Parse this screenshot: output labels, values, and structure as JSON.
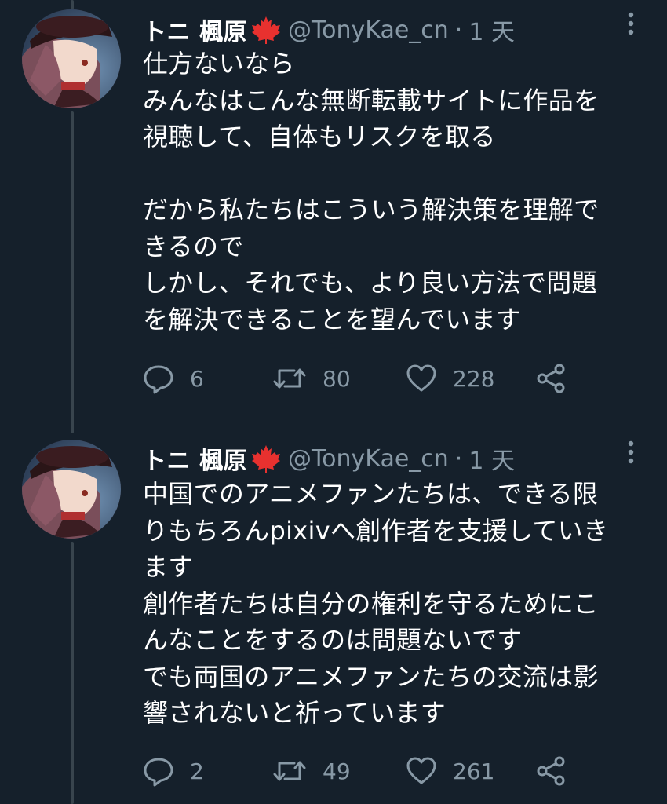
{
  "tweets": [
    {
      "name": "トニ 楓原",
      "handle": "@TonyKae_cn",
      "dot": "·",
      "time": "1 天",
      "lines": [
        "仕方ないなら",
        "みんなはこんな無断転載サイトに作品を",
        "視聴して、自体もリスクを取る",
        "",
        "だから私たちはこういう解決策を理解で",
        "きるので",
        "しかし、それでも、より良い方法で問題",
        "を解決できることを望んでいます"
      ],
      "replies": "6",
      "retweets": "80",
      "likes": "228"
    },
    {
      "name": "トニ 楓原",
      "handle": "@TonyKae_cn",
      "dot": "·",
      "time": "1 天",
      "lines": [
        "中国でのアニメファンたちは、できる限",
        "りもちろんpixivへ創作者を支援していき",
        "ます",
        "創作者たちは自分の権利を守るためにこ",
        "んなことをするのは問題ないです",
        "でも両国のアニメファンたちの交流は影",
        "響されないと祈っています"
      ],
      "replies": "2",
      "retweets": "49",
      "likes": "261"
    }
  ],
  "icons": {
    "flag": "maple-leaf-icon",
    "reply": "reply-icon",
    "retweet": "retweet-icon",
    "like": "heart-icon",
    "share": "share-icon",
    "more": "more-vertical-icon"
  },
  "colors": {
    "background": "#15202b",
    "text": "#ffffff",
    "secondary": "#8899a6",
    "thread_line": "#38444d",
    "flag_red": "#e8312f"
  }
}
